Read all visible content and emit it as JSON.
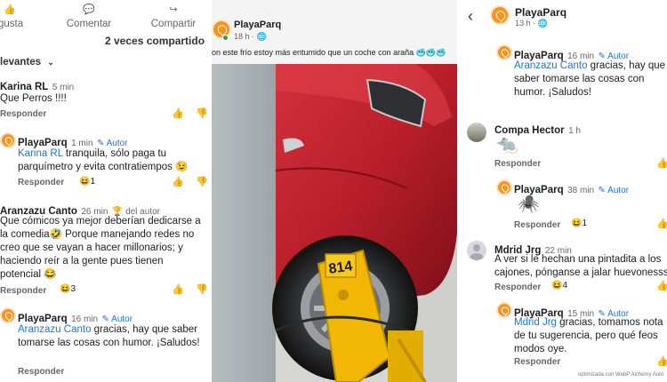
{
  "left": {
    "actions": {
      "like": "gusta",
      "comment": "Comentar",
      "share": "Compartir"
    },
    "shared_text": "2 veces compartido",
    "sort_label": "levantes",
    "comments": [
      {
        "name": "Karina RL",
        "time": "5 min",
        "text": "Que Perros !!!!",
        "reply": "Responder"
      },
      {
        "name": "PlayaParq",
        "time": "1 min",
        "author": "Autor",
        "mention": "Karina RL",
        "text": " tranquila, sólo paga tu parquímetro y evita contratiempos 😉",
        "reply": "Responder",
        "reaction_count": "1"
      },
      {
        "name": "Aranzazu Canto",
        "time": "26 min",
        "badge": "del autor",
        "text": "Que cómicos ya mejor deberían dedicarse a la comedia🤣 Porque manejando redes no creo que se vayan a hacer millonarios; y haciendo reír a la gente pues tienen potencial 😂",
        "reply": "Responder",
        "reaction_count": "3"
      },
      {
        "name": "PlayaParq",
        "time": "16 min",
        "author": "Autor",
        "mention": "Aranzazu Canto",
        "text": " gracias, hay que saber tomarse las cosas con humor. ¡Saludos!",
        "reply": "Responder"
      }
    ]
  },
  "mid": {
    "page_name": "PlayaParq",
    "time": "18 h",
    "caption": "on este frío estoy más entumido que un coche con araña 🥶🥶🥶",
    "plate": "814"
  },
  "right": {
    "header": {
      "name": "PlayaParq",
      "time": "13 h"
    },
    "comments": [
      {
        "name": "PlayaParq",
        "time": "16 min",
        "author": "Autor",
        "mention": "Aranzazu Canto",
        "text": " gracias, hay que saber tomarse las cosas con humor. ¡Saludos!"
      },
      {
        "name": "Compa Hector",
        "time": "1 h",
        "sticker": "🐀",
        "reply": "Responder"
      },
      {
        "name": "PlayaParq",
        "time": "38 min",
        "author": "Autor",
        "sticker": "🕷️",
        "reply": "Responder",
        "reaction_count": "1"
      },
      {
        "name": "Mdrid Jrg",
        "time": "22 min",
        "text": "A ver si le hechan una pintadita a los cajones, pónganse a jalar huevonesss",
        "reply": "Responder",
        "reaction_count": "4"
      },
      {
        "name": "PlayaParq",
        "time": "15 min",
        "author": "Autor",
        "mention": "Mdrid Jrg",
        "text": " gracias, tomamos nota de tu sugerencia, pero qué feos modos oye.",
        "reply": "Responder"
      }
    ],
    "watermark": "optimizada con WebP Alchemy Autó"
  }
}
